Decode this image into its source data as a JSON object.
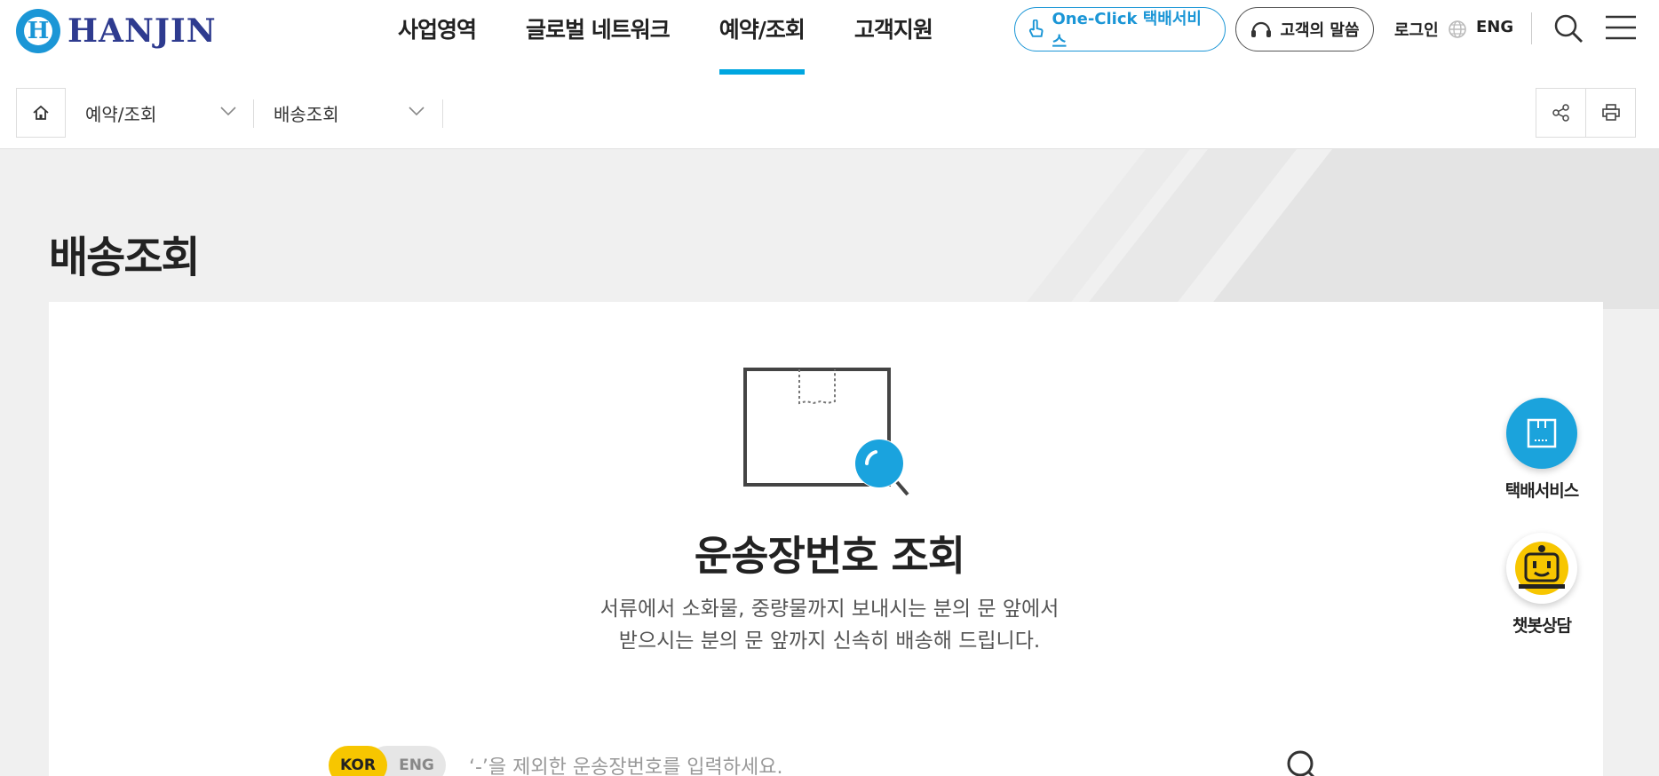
{
  "brand": {
    "name": "HANJIN",
    "mark": "H"
  },
  "gnb": [
    {
      "label": "사업영역",
      "active": false
    },
    {
      "label": "글로벌 네트워크",
      "active": false
    },
    {
      "label": "예약/조회",
      "active": true
    },
    {
      "label": "고객지원",
      "active": false
    }
  ],
  "util": {
    "oneclick": "One-Click 택배서비스",
    "voice": "고객의 말씀",
    "login": "로그인",
    "lang": "ENG"
  },
  "breadcrumb": {
    "level1": "예약/조회",
    "level2": "배송조회"
  },
  "page": {
    "title": "배송조회"
  },
  "tracking": {
    "title": "운송장번호 조회",
    "desc_line1": "서류에서 소화물, 중량물까지 보내시는 분의 문 앞에서",
    "desc_line2": "받으시는 분의 문 앞까지 신속히 배송해 드립니다.",
    "lang_kor": "KOR",
    "lang_eng": "ENG",
    "placeholder": "‘-’을 제외한 운송장번호를 입력하세요."
  },
  "floating": {
    "delivery": "택배서비스",
    "chat": "챗봇상담"
  },
  "colors": {
    "accent": "#00a6e0",
    "brand_navy": "#2e3b8f",
    "kor_yellow": "#f7c600"
  }
}
